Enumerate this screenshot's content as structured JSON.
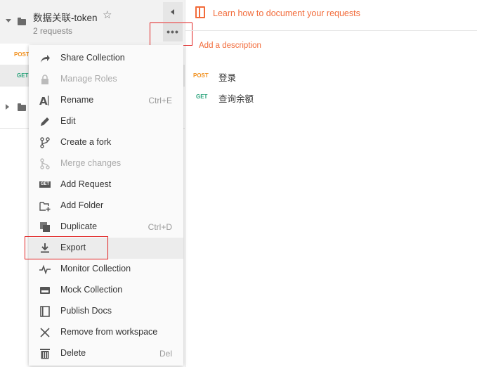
{
  "collection": {
    "name": "数据关联-token",
    "count": "2 requests",
    "more_label": "•••"
  },
  "sidebar_requests": [
    {
      "method": "POST"
    },
    {
      "method": "GET"
    }
  ],
  "right": {
    "learn_link": "Learn how to document your requests",
    "add_description": "Add a description",
    "requests": [
      {
        "method": "POST",
        "name": "登录"
      },
      {
        "method": "GET",
        "name": "查询余额"
      }
    ]
  },
  "menu": {
    "items": [
      {
        "label": "Share Collection",
        "shortcut": "",
        "icon": "share-arrow-icon"
      },
      {
        "label": "Manage Roles",
        "shortcut": "",
        "icon": "lock-icon",
        "disabled": true
      },
      {
        "label": "Rename",
        "shortcut": "Ctrl+E",
        "icon": "rename-icon"
      },
      {
        "label": "Edit",
        "shortcut": "",
        "icon": "pencil-icon"
      },
      {
        "label": "Create a fork",
        "shortcut": "",
        "icon": "fork-icon"
      },
      {
        "label": "Merge changes",
        "shortcut": "",
        "icon": "merge-icon",
        "disabled": true
      },
      {
        "label": "Add Request",
        "shortcut": "",
        "icon": "get-request-icon",
        "badge": "GET"
      },
      {
        "label": "Add Folder",
        "shortcut": "",
        "icon": "add-folder-icon"
      },
      {
        "label": "Duplicate",
        "shortcut": "Ctrl+D",
        "icon": "duplicate-icon"
      },
      {
        "label": "Export",
        "shortcut": "",
        "icon": "export-icon"
      },
      {
        "label": "Monitor Collection",
        "shortcut": "",
        "icon": "monitor-pulse-icon"
      },
      {
        "label": "Mock Collection",
        "shortcut": "",
        "icon": "mock-server-icon"
      },
      {
        "label": "Publish Docs",
        "shortcut": "",
        "icon": "publish-docs-icon"
      },
      {
        "label": "Remove from workspace",
        "shortcut": "",
        "icon": "close-x-icon"
      },
      {
        "label": "Delete",
        "shortcut": "Del",
        "icon": "trash-icon"
      }
    ]
  },
  "colors": {
    "accent": "#f26b3a",
    "post": "#f29221",
    "get": "#2aa37b",
    "highlight_box": "#e02020"
  }
}
